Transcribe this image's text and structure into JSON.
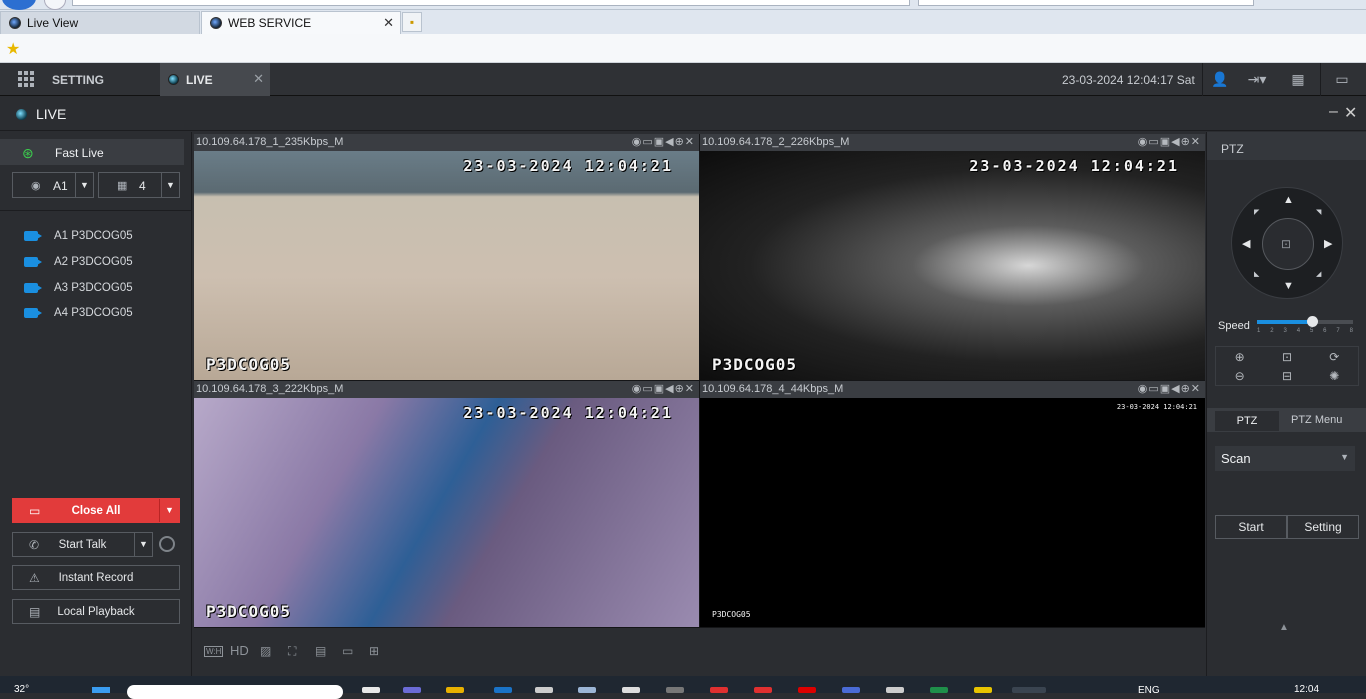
{
  "browser": {
    "tabs": [
      {
        "label": "Live View",
        "active": false
      },
      {
        "label": "WEB SERVICE",
        "active": true
      }
    ]
  },
  "app": {
    "header": {
      "setting_label": "SETTING",
      "live_tab_label": "LIVE",
      "datetime": "23-03-2024 12:04:17 Sat"
    },
    "live_bar_title": "LIVE",
    "left_panel": {
      "fast_live_label": "Fast Live",
      "channel_select": "A1",
      "split_select": "4",
      "cameras": [
        "A1 P3DCOG05",
        "A2 P3DCOG05",
        "A3 P3DCOG05",
        "A4 P3DCOG05"
      ],
      "buttons": {
        "close_all": "Close All",
        "start_talk": "Start Talk",
        "instant_record": "Instant Record",
        "local_playback": "Local Playback"
      }
    },
    "video": {
      "cells": [
        {
          "title": "10.109.64.178_1_235Kbps_M",
          "osd_time": "23-03-2024 12:04:21",
          "osd_name": "P3DCOG05"
        },
        {
          "title": "10.109.64.178_2_226Kbps_M",
          "osd_time": "23-03-2024 12:04:21",
          "osd_name": "P3DCOG05"
        },
        {
          "title": "10.109.64.178_3_222Kbps_M",
          "osd_time": "23-03-2024 12:04:21",
          "osd_name": "P3DCOG05"
        },
        {
          "title": "10.109.64.178_4_44Kbps_M",
          "osd_time": "23-03-2024 12:04:21",
          "osd_name": "P3DCOG05"
        }
      ],
      "toolbar": {
        "wh_label": "W:H",
        "hd_label": "HD"
      }
    },
    "ptz": {
      "title": "PTZ",
      "speed_label": "Speed",
      "speed_level": 5,
      "speed_ticks": [
        "1",
        "2",
        "3",
        "4",
        "5",
        "6",
        "7",
        "8"
      ],
      "tabs": [
        "PTZ",
        "PTZ Menu"
      ],
      "mode_select": "Scan",
      "start_label": "Start",
      "setting_label": "Setting"
    }
  },
  "taskbar": {
    "temperature": "32°",
    "language": "ENG",
    "time": "12:04"
  }
}
